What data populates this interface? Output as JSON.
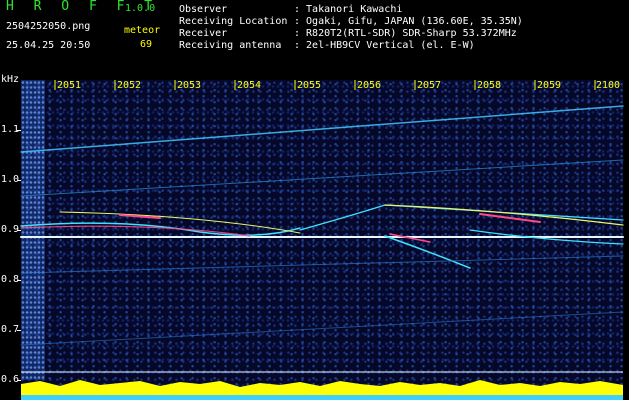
{
  "header": {
    "app_title": "H R O F F T",
    "version": "1.0.0",
    "filename": "2504252050.png",
    "datetime": "25.04.25 20:50",
    "meteor_label": "meteor",
    "meteor_count": "69"
  },
  "info": [
    {
      "key": "Observer",
      "value": ": Takanori Kawachi"
    },
    {
      "key": "Receiving Location",
      "value": ": Ogaki, Gifu, JAPAN (136.60E, 35.35N)"
    },
    {
      "key": "Receiver",
      "value": ": R820T2(RTL-SDR) SDR-Sharp 53.372MHz"
    },
    {
      "key": "Receiving antenna",
      "value": ": 2el-HB9CV Vertical (el. E-W)"
    }
  ],
  "axis": {
    "unit": "kHz",
    "time_ticks": [
      "2051",
      "2052",
      "2053",
      "2054",
      "2055",
      "2056",
      "2057",
      "2058",
      "2059",
      "2100"
    ],
    "freq_ticks": [
      "1.1",
      "1.0",
      "0.9",
      "0.8",
      "0.7",
      "0.6"
    ]
  },
  "colors": {
    "title_green": "#2ee62e",
    "meteor_yellow": "#ffff00",
    "background": "#000000",
    "spectrogram_bg": "#06082a",
    "trace_cyan": "#40e0ff",
    "trace_white": "#e6f6ff",
    "meteor_red": "#ff4a8a",
    "trace_yellow": "#e8f56a",
    "baseline_bar": "#ffff00"
  }
}
